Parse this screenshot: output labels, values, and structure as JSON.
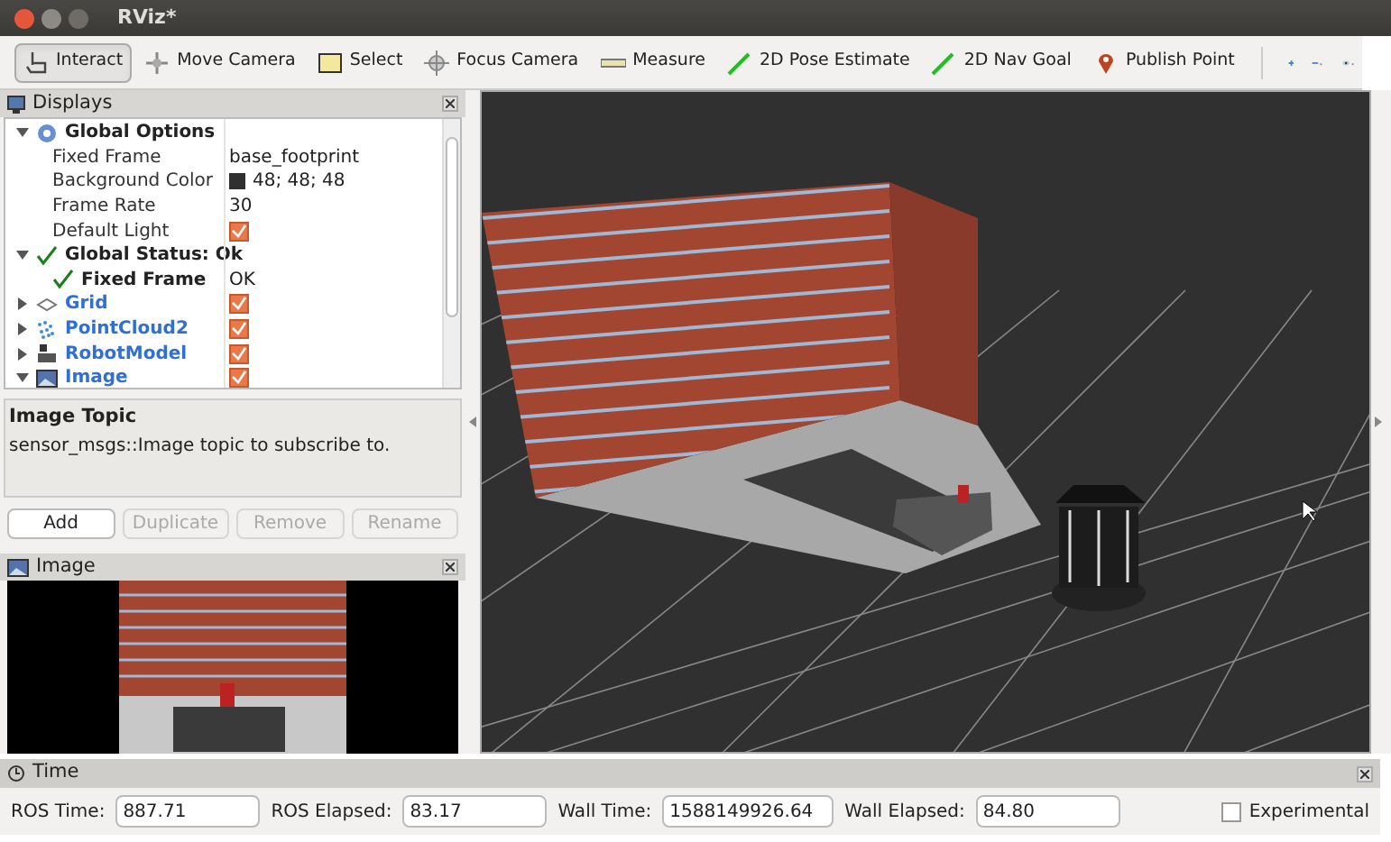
{
  "window": {
    "title": "RViz*"
  },
  "toolbar": {
    "tools": [
      {
        "kind": "interact",
        "label": "Interact",
        "selected": true
      },
      {
        "kind": "move",
        "label": "Move Camera",
        "selected": false
      },
      {
        "kind": "select",
        "label": "Select",
        "selected": false
      },
      {
        "kind": "focus",
        "label": "Focus Camera",
        "selected": false
      },
      {
        "kind": "measure",
        "label": "Measure",
        "selected": false
      },
      {
        "kind": "pose",
        "label": "2D Pose Estimate",
        "selected": false
      },
      {
        "kind": "goal",
        "label": "2D Nav Goal",
        "selected": false
      },
      {
        "kind": "point",
        "label": "Publish Point",
        "selected": false
      }
    ]
  },
  "displays": {
    "title": "Displays",
    "items": [
      {
        "kind": "options",
        "label": "Global Options",
        "expanded": true,
        "children": [
          {
            "kind": "property",
            "label": "Fixed Frame",
            "value": "base_footprint"
          },
          {
            "kind": "color",
            "label": "Background Color",
            "value": "48; 48; 48"
          },
          {
            "kind": "property",
            "label": "Frame Rate",
            "value": "30"
          },
          {
            "kind": "check",
            "label": "Default Light",
            "checked": true
          }
        ]
      },
      {
        "kind": "status",
        "label": "Global Status: Ok",
        "expanded": true,
        "children": [
          {
            "kind": "status",
            "label": "Fixed Frame",
            "value": "OK"
          }
        ]
      },
      {
        "kind": "grid",
        "label": "Grid",
        "expanded": false,
        "checked": true
      },
      {
        "kind": "cloud",
        "label": "PointCloud2",
        "expanded": false,
        "checked": true
      },
      {
        "kind": "robot",
        "label": "RobotModel",
        "expanded": false,
        "checked": true
      },
      {
        "kind": "image",
        "label": "Image",
        "expanded": true,
        "checked": true
      }
    ],
    "description": {
      "title": "Image Topic",
      "text": "sensor_msgs::Image topic to subscribe to."
    },
    "buttons": [
      {
        "label": "Add",
        "disabled": false
      },
      {
        "label": "Duplicate",
        "disabled": true
      },
      {
        "label": "Remove",
        "disabled": true
      },
      {
        "label": "Rename",
        "disabled": true
      }
    ]
  },
  "image_panel": {
    "title": "Image"
  },
  "time": {
    "title": "Time",
    "fields": [
      {
        "label": "ROS Time:",
        "value": "887.71"
      },
      {
        "label": "ROS Elapsed:",
        "value": "83.17"
      },
      {
        "label": "Wall Time:",
        "value": "1588149926.64"
      },
      {
        "label": "Wall Elapsed:",
        "value": "84.80"
      }
    ],
    "experimental": {
      "label": "Experimental",
      "checked": false
    }
  }
}
